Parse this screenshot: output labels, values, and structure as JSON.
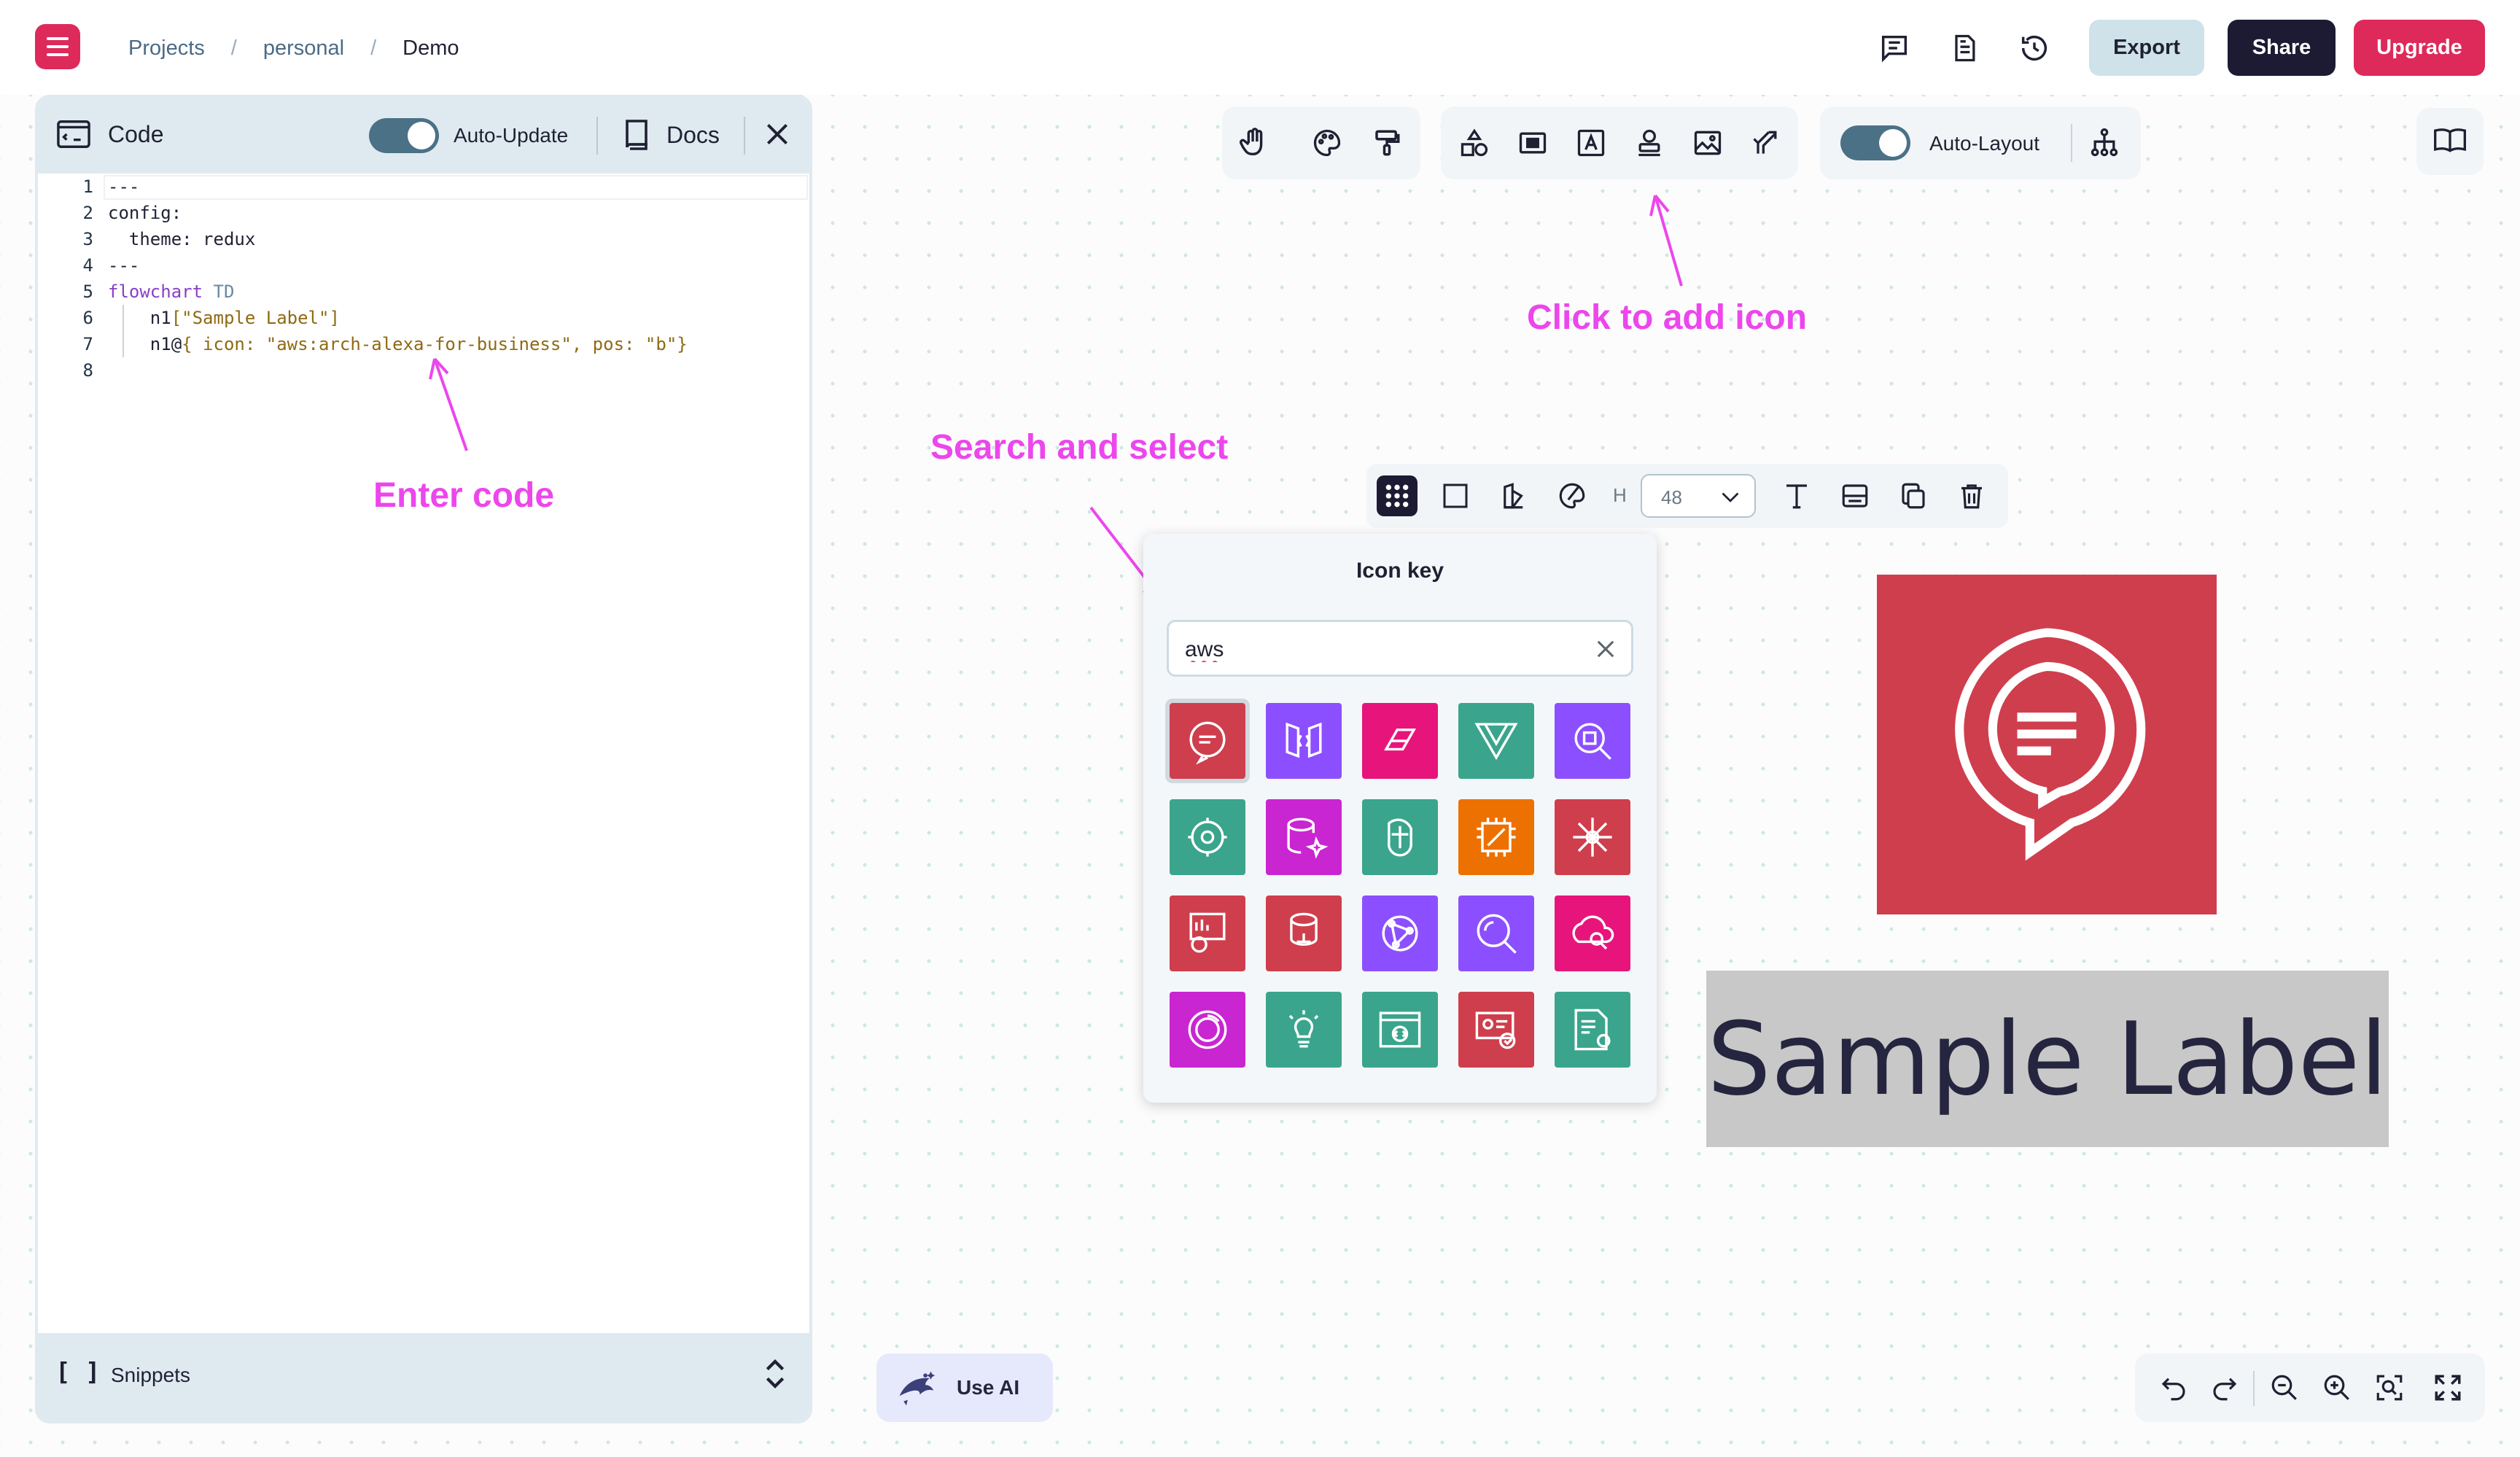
{
  "header": {
    "breadcrumb": [
      {
        "label": "Projects"
      },
      {
        "label": "personal"
      },
      {
        "label": "Demo"
      }
    ],
    "separator": "/",
    "export_label": "Export",
    "share_label": "Share",
    "upgrade_label": "Upgrade",
    "icons": [
      "comment-icon",
      "document-icon",
      "history-icon"
    ]
  },
  "code_panel": {
    "title": "Code",
    "auto_update_label": "Auto-Update",
    "auto_update_on": true,
    "docs_label": "Docs",
    "lines": [
      {
        "n": "1",
        "text": "---"
      },
      {
        "n": "2",
        "text": "config:"
      },
      {
        "n": "3",
        "text": "  theme: redux"
      },
      {
        "n": "4",
        "text": "---"
      },
      {
        "n": "5",
        "kw": "flowchart",
        "rest": " TD"
      },
      {
        "n": "6",
        "prefix": "    n1",
        "str": "[\"Sample Label\"]"
      },
      {
        "n": "7",
        "prefix": "    n1@",
        "str": "{ icon: \"aws:arch-alexa-for-business\", pos: \"b\"}"
      },
      {
        "n": "8",
        "text": ""
      }
    ],
    "snippets_bracket": "[ ]",
    "snippets_label": "Snippets"
  },
  "annotations": {
    "enter_code": "Enter code",
    "click_to_add_icon": "Click to add icon",
    "search_and_select": "Search and select",
    "color": "#ec46ec"
  },
  "toolbar": {
    "auto_layout_label": "Auto-Layout",
    "auto_layout_on": true
  },
  "node_toolbar": {
    "h_label": "H",
    "height_value": "48"
  },
  "icon_popup": {
    "title": "Icon key",
    "search_value": "aws",
    "icons": [
      {
        "name": "alexa-for-business-icon",
        "color": "#cf3e4d"
      },
      {
        "name": "api-gateway-icon",
        "color": "#8c4fff"
      },
      {
        "name": "app-flow-icon",
        "color": "#e7157b"
      },
      {
        "name": "app-mesh-icon",
        "color": "#3aa58c"
      },
      {
        "name": "app-search-icon",
        "color": "#8c4fff"
      },
      {
        "name": "brain-gear-icon",
        "color": "#3aa58c"
      },
      {
        "name": "database-sparkle-icon",
        "color": "#c925d1"
      },
      {
        "name": "ai-brain-icon",
        "color": "#3aa58c"
      },
      {
        "name": "chip-icon",
        "color": "#ed7100"
      },
      {
        "name": "burst-icon",
        "color": "#cf3e4d"
      },
      {
        "name": "chart-brain-icon",
        "color": "#cf3e4d"
      },
      {
        "name": "database-tree-icon",
        "color": "#cf3e4d"
      },
      {
        "name": "globe-network-icon",
        "color": "#8c4fff"
      },
      {
        "name": "search-glass-icon",
        "color": "#8c4fff"
      },
      {
        "name": "cloud-search-icon",
        "color": "#e7157b"
      },
      {
        "name": "ring-icon",
        "color": "#c925d1"
      },
      {
        "name": "lightbulb-icon",
        "color": "#3aa58c"
      },
      {
        "name": "browser-code-icon",
        "color": "#3aa58c"
      },
      {
        "name": "id-card-check-icon",
        "color": "#cf3e4d"
      },
      {
        "name": "document-bulb-icon",
        "color": "#3aa58c"
      }
    ]
  },
  "node": {
    "label": "Sample Label",
    "icon_color": "#cf3e4d"
  },
  "bottom": {
    "use_ai_label": "Use AI"
  },
  "colors": {
    "brand": "#dd2a5b",
    "dark": "#1d1b33",
    "panel": "#dfeaf0",
    "toggle": "#4a7186"
  }
}
